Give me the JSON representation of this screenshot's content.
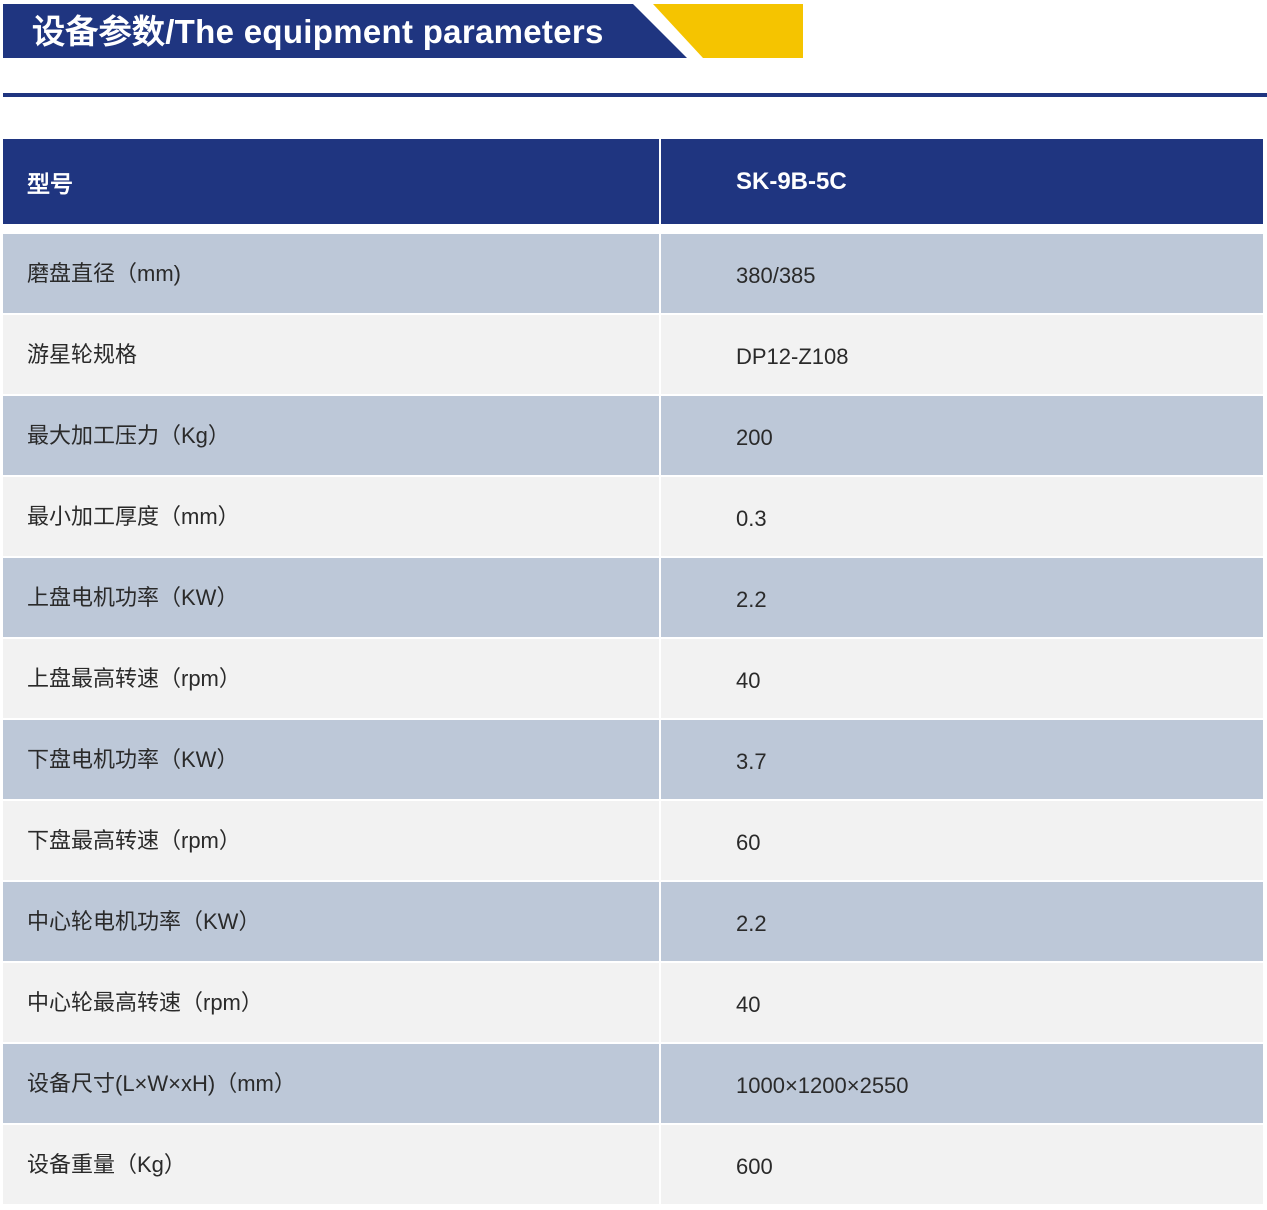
{
  "header": {
    "title": "设备参数/The equipment parameters",
    "accent_color": "#f5c400",
    "brand_color": "#1f3580"
  },
  "table": {
    "columns": [
      "型号",
      "SK-9B-5C"
    ],
    "rows": [
      {
        "label": "磨盘直径（mm)",
        "value": "380/385"
      },
      {
        "label": "游星轮规格",
        "value": "DP12-Z108"
      },
      {
        "label": "最大加工压力（Kg）",
        "value": "200"
      },
      {
        "label": "最小加工厚度（mm）",
        "value": "0.3"
      },
      {
        "label": "上盘电机功率（KW）",
        "value": "2.2"
      },
      {
        "label": "上盘最高转速（rpm）",
        "value": "40"
      },
      {
        "label": "下盘电机功率（KW）",
        "value": "3.7"
      },
      {
        "label": "下盘最高转速（rpm）",
        "value": "60"
      },
      {
        "label": "中心轮电机功率（KW）",
        "value": "2.2"
      },
      {
        "label": "中心轮最高转速（rpm）",
        "value": "40"
      },
      {
        "label": "设备尺寸(L×W×xH)（mm）",
        "value": "1000×1200×2550"
      },
      {
        "label": "设备重量（Kg）",
        "value": "600"
      }
    ]
  }
}
